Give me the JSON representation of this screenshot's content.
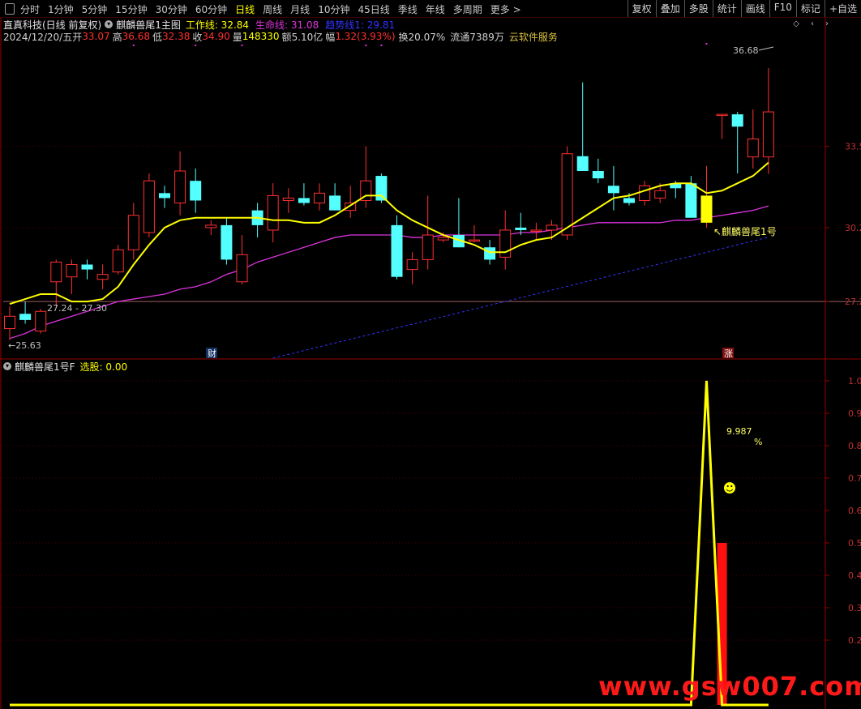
{
  "toolbar": {
    "periods": [
      "分时",
      "1分钟",
      "5分钟",
      "15分钟",
      "30分钟",
      "60分钟",
      "日线",
      "周线",
      "月线",
      "10分钟",
      "45日线",
      "季线",
      "年线",
      "多周期",
      "更多 >"
    ],
    "active_index": 6,
    "right_buttons": [
      "复权",
      "叠加",
      "多股",
      "统计",
      "画线",
      "F10",
      "标记",
      "+自选"
    ]
  },
  "header": {
    "stock": "直真科技(日线 前复权)",
    "indicator": "麒麟兽尾1主图",
    "work_label": "工作线: 32.84",
    "life_label": "生命线: 31.08",
    "trend_label": "趋势线1: 29.81",
    "date": "2024/12/20/五",
    "open_label": "开",
    "open": "33.07",
    "high_label": "高",
    "high": "36.68",
    "low_label": "低",
    "low": "32.38",
    "close_label": "收",
    "close": "34.90",
    "vol_label": "量",
    "vol": "148330",
    "amt_label": "额",
    "amt": "5.10亿",
    "chg_label": "幅",
    "chg": "1.32(3.93%)",
    "turn": "换20.07%",
    "float": "流通7389万",
    "service": "云软件服务"
  },
  "sub_header": {
    "indicator": "麒麟兽尾1号F",
    "select_label": "选股: 0.00"
  },
  "colors": {
    "up": "#ff3030",
    "down": "#54ffff",
    "work": "#ffff00",
    "life": "#dd33dd",
    "trend": "#3333ff",
    "magenta_dot": "#dd33dd",
    "axis": "#990000"
  },
  "watermark": "www.gsw007.com",
  "chart_data": [
    {
      "type": "candlestick",
      "title": "",
      "y_ticks": [
        27.2,
        30.2,
        33.5
      ],
      "y_tick_labels": [
        "27.2",
        "30.2",
        "33.5"
      ],
      "ylim": [
        24.9,
        37.6
      ],
      "reference_line": 27.2,
      "annotations": {
        "high_marker": "36.68",
        "low_marker": "←25.63",
        "range_label": "27.24 - 27.30",
        "signal_label": "↖麒麟兽尾1号",
        "fin_tag": "财",
        "rise_tag": "涨"
      },
      "candles": [
        {
          "o": 26.1,
          "h": 27.0,
          "l": 25.63,
          "c": 26.6
        },
        {
          "o": 26.7,
          "h": 27.2,
          "l": 26.3,
          "c": 26.45
        },
        {
          "o": 26.0,
          "h": 26.9,
          "l": 25.9,
          "c": 26.8
        },
        {
          "o": 28.0,
          "h": 28.9,
          "l": 27.0,
          "c": 28.8
        },
        {
          "o": 28.2,
          "h": 28.9,
          "l": 27.5,
          "c": 28.7
        },
        {
          "o": 28.7,
          "h": 28.9,
          "l": 28.1,
          "c": 28.5
        },
        {
          "o": 28.1,
          "h": 28.7,
          "l": 27.7,
          "c": 28.3
        },
        {
          "o": 28.4,
          "h": 29.5,
          "l": 28.3,
          "c": 29.3
        },
        {
          "o": 29.3,
          "h": 31.2,
          "l": 28.9,
          "c": 30.7
        },
        {
          "o": 30.0,
          "h": 32.4,
          "l": 29.8,
          "c": 32.1
        },
        {
          "o": 31.6,
          "h": 31.9,
          "l": 31.0,
          "c": 31.4
        },
        {
          "o": 31.2,
          "h": 33.3,
          "l": 30.7,
          "c": 32.5
        },
        {
          "o": 32.1,
          "h": 32.6,
          "l": 30.8,
          "c": 31.3
        },
        {
          "o": 30.2,
          "h": 30.5,
          "l": 29.9,
          "c": 30.3
        },
        {
          "o": 30.3,
          "h": 30.6,
          "l": 28.7,
          "c": 28.9
        },
        {
          "o": 28.0,
          "h": 29.9,
          "l": 27.9,
          "c": 29.1
        },
        {
          "o": 30.9,
          "h": 31.2,
          "l": 29.8,
          "c": 30.3
        },
        {
          "o": 30.1,
          "h": 32.0,
          "l": 29.6,
          "c": 31.5
        },
        {
          "o": 31.3,
          "h": 31.8,
          "l": 30.8,
          "c": 31.4
        },
        {
          "o": 31.4,
          "h": 32.0,
          "l": 31.1,
          "c": 31.2
        },
        {
          "o": 31.2,
          "h": 32.0,
          "l": 30.9,
          "c": 31.6
        },
        {
          "o": 31.5,
          "h": 32.0,
          "l": 30.9,
          "c": 30.9
        },
        {
          "o": 30.9,
          "h": 31.9,
          "l": 30.6,
          "c": 31.2
        },
        {
          "o": 31.3,
          "h": 33.5,
          "l": 31.0,
          "c": 32.1
        },
        {
          "o": 32.3,
          "h": 32.4,
          "l": 31.2,
          "c": 31.3
        },
        {
          "o": 30.3,
          "h": 30.7,
          "l": 28.1,
          "c": 28.2
        },
        {
          "o": 28.5,
          "h": 29.2,
          "l": 27.9,
          "c": 28.9
        },
        {
          "o": 28.9,
          "h": 31.5,
          "l": 28.5,
          "c": 29.9
        },
        {
          "o": 29.7,
          "h": 30.0,
          "l": 29.6,
          "c": 29.8
        },
        {
          "o": 29.9,
          "h": 31.4,
          "l": 29.4,
          "c": 29.4
        },
        {
          "o": 29.7,
          "h": 30.3,
          "l": 29.6,
          "c": 29.7
        },
        {
          "o": 29.4,
          "h": 29.7,
          "l": 28.7,
          "c": 28.9
        },
        {
          "o": 29.0,
          "h": 30.9,
          "l": 28.5,
          "c": 30.1
        },
        {
          "o": 30.2,
          "h": 30.8,
          "l": 29.9,
          "c": 30.1
        },
        {
          "o": 30.1,
          "h": 30.4,
          "l": 29.7,
          "c": 30.1
        },
        {
          "o": 30.1,
          "h": 30.5,
          "l": 29.7,
          "c": 30.3
        },
        {
          "o": 29.9,
          "h": 33.5,
          "l": 29.7,
          "c": 33.2
        },
        {
          "o": 33.1,
          "h": 36.1,
          "l": 33.0,
          "c": 32.5
        },
        {
          "o": 32.5,
          "h": 33.0,
          "l": 32.0,
          "c": 32.2
        },
        {
          "o": 31.9,
          "h": 32.7,
          "l": 30.9,
          "c": 31.6
        },
        {
          "o": 31.4,
          "h": 31.6,
          "l": 31.1,
          "c": 31.2
        },
        {
          "o": 31.3,
          "h": 32.1,
          "l": 31.1,
          "c": 31.9
        },
        {
          "o": 31.4,
          "h": 32.0,
          "l": 31.2,
          "c": 31.7
        },
        {
          "o": 32.0,
          "h": 32.1,
          "l": 31.4,
          "c": 31.8
        },
        {
          "o": 32.0,
          "h": 32.3,
          "l": 31.6,
          "c": 30.6
        },
        {
          "o": 30.4,
          "h": 32.7,
          "l": 30.2,
          "c": 31.5
        },
        {
          "o": 34.8,
          "h": 34.8,
          "l": 33.8,
          "c": 34.8
        },
        {
          "o": 34.8,
          "h": 34.9,
          "l": 32.4,
          "c": 34.3
        },
        {
          "o": 33.07,
          "h": 35.0,
          "l": 32.6,
          "c": 33.8
        },
        {
          "o": 33.07,
          "h": 36.68,
          "l": 32.38,
          "c": 34.9
        }
      ],
      "work_line": [
        27.1,
        27.3,
        27.5,
        27.5,
        27.2,
        27.2,
        27.3,
        27.8,
        28.7,
        29.5,
        30.2,
        30.5,
        30.6,
        30.6,
        30.6,
        30.6,
        30.6,
        30.5,
        30.5,
        30.4,
        30.4,
        30.7,
        31.1,
        31.5,
        31.5,
        30.9,
        30.5,
        30.2,
        29.9,
        29.7,
        29.5,
        29.2,
        29.2,
        29.5,
        29.7,
        29.8,
        30.2,
        30.6,
        31.0,
        31.4,
        31.5,
        31.7,
        31.9,
        32.0,
        32.0,
        31.6,
        31.7,
        32.0,
        32.3,
        32.84
      ],
      "life_line": [
        25.7,
        25.9,
        26.2,
        26.4,
        26.6,
        26.8,
        27.0,
        27.2,
        27.3,
        27.4,
        27.5,
        27.7,
        27.8,
        28.0,
        28.3,
        28.5,
        28.8,
        29.0,
        29.2,
        29.4,
        29.6,
        29.8,
        29.9,
        29.9,
        29.9,
        29.9,
        29.8,
        29.8,
        29.9,
        29.9,
        29.9,
        29.9,
        29.9,
        30.0,
        30.0,
        30.1,
        30.2,
        30.3,
        30.4,
        30.4,
        30.4,
        30.4,
        30.4,
        30.5,
        30.5,
        30.6,
        30.7,
        30.8,
        30.9,
        31.08
      ],
      "trend_line": {
        "start_index": 17,
        "start_value": 24.9,
        "end_index": 49,
        "end_value": 29.81
      },
      "signal_index": 45
    },
    {
      "type": "line",
      "title": "",
      "y_ticks": [
        0.2,
        0.3,
        0.4,
        0.5,
        0.6,
        0.7,
        0.8,
        0.9,
        1.0
      ],
      "y_tick_labels": [
        "0.2",
        "0.3",
        "0.4",
        "0.5",
        "0.6",
        "0.7",
        "0.8",
        "0.9",
        "1.0"
      ],
      "ylim": [
        0,
        1.02
      ],
      "series": [
        {
          "values": [
            0,
            0,
            0,
            0,
            0,
            0,
            0,
            0,
            0,
            0,
            0,
            0,
            0,
            0,
            0,
            0,
            0,
            0,
            0,
            0,
            0,
            0,
            0,
            0,
            0,
            0,
            0,
            0,
            0,
            0,
            0,
            0,
            0,
            0,
            0,
            0,
            0,
            0,
            0,
            0,
            0,
            0,
            0,
            0,
            0,
            1.0,
            0,
            0,
            0,
            0
          ]
        }
      ],
      "bar": {
        "index": 46,
        "value": 0.5
      },
      "annotations": {
        "value_label": "9.987",
        "pct": "%",
        "smiley": "☻"
      }
    }
  ]
}
